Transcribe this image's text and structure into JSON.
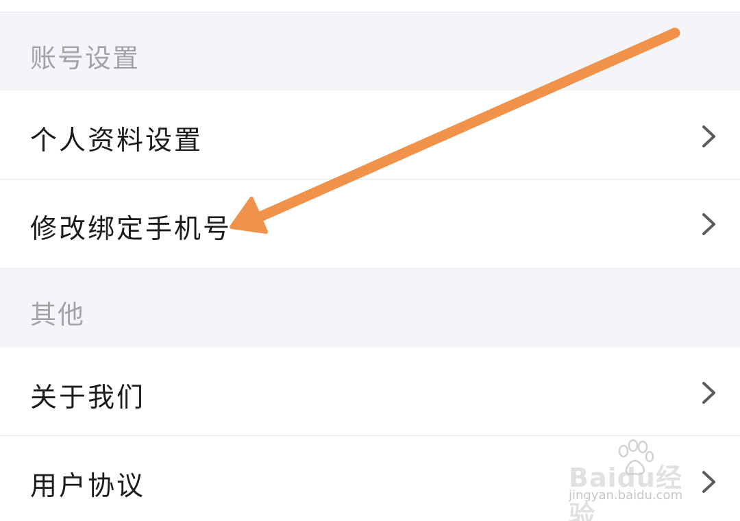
{
  "sections": [
    {
      "header": "账号设置",
      "items": [
        {
          "label": "个人资料设置"
        },
        {
          "label": "修改绑定手机号"
        }
      ]
    },
    {
      "header": "其他",
      "items": [
        {
          "label": "关于我们"
        },
        {
          "label": "用户协议"
        }
      ]
    }
  ],
  "colors": {
    "header_bg": "#f4f5f9",
    "header_text": "#a1a3a8",
    "item_text": "#1b1b1d",
    "chevron": "#5a5c62",
    "annotation_arrow": "#f0924a"
  },
  "icons": {
    "chevron": "chevron-right-icon",
    "annotation": "arrow-annotation",
    "watermark_logo": "baidu-paw-logo"
  },
  "watermark": {
    "brand": "Baidu经验",
    "url": "jingyan.baidu.com"
  }
}
